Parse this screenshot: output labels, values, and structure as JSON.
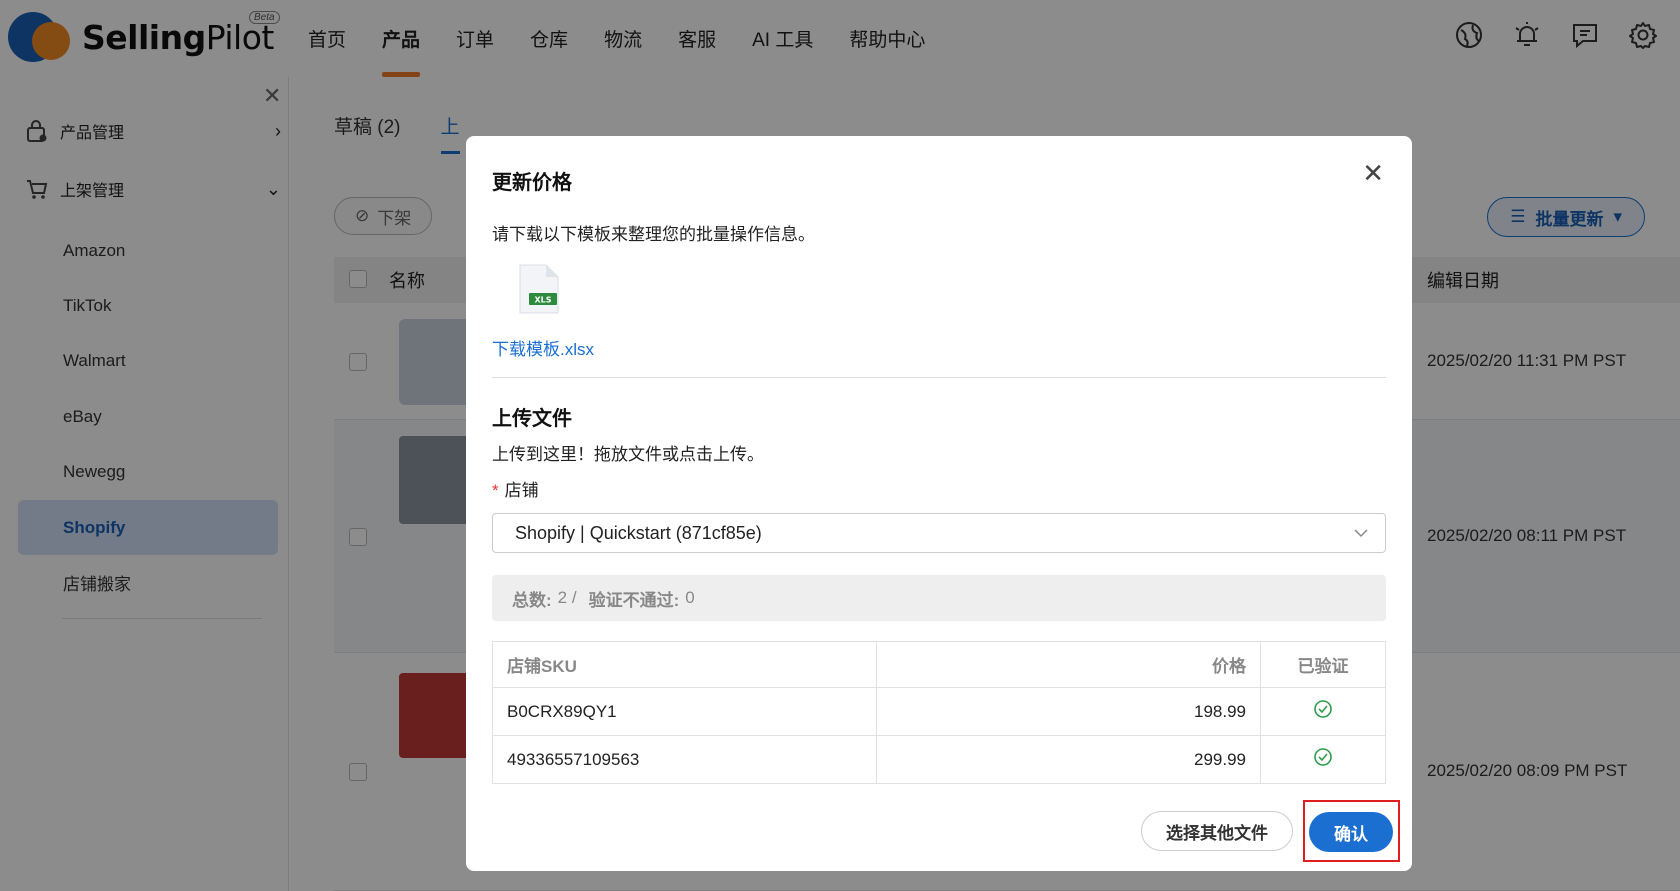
{
  "brand": {
    "name_bold": "Selling",
    "name_rest": "Pilot",
    "badge": "Beta"
  },
  "nav": {
    "items": [
      "首页",
      "产品",
      "订单",
      "仓库",
      "物流",
      "客服",
      "AI 工具",
      "帮助中心"
    ],
    "active": "产品"
  },
  "top_icons": [
    "globe-icon",
    "bell-icon",
    "chat-icon",
    "gear-icon"
  ],
  "sidebar": {
    "groups": [
      "产品管理",
      "上架管理"
    ],
    "items": [
      "Amazon",
      "TikTok",
      "Walmart",
      "eBay",
      "Newegg",
      "Shopify",
      "店铺搬家"
    ],
    "active": "Shopify"
  },
  "main": {
    "tabs": [
      "草稿 (2)",
      "上"
    ],
    "delist_label": "下架",
    "bulk_label": "批量更新",
    "columns": {
      "name": "名称",
      "edit_date": "编辑日期"
    },
    "rows": [
      {
        "date": "2025/02/20 11:31 PM PST"
      },
      {
        "date": "2025/02/20 08:11 PM PST"
      },
      {
        "date": "2025/02/20 08:09 PM PST"
      }
    ]
  },
  "modal": {
    "title": "更新价格",
    "hint": "请下载以下模板来整理您的批量操作信息。",
    "file_badge": "XLS",
    "download_link": "下载模板.xlsx",
    "upload_title": "上传文件",
    "upload_hint": "上传到这里！拖放文件或点击上传。",
    "store_label": "店铺",
    "store_value": "Shopify | Quickstart (871cf85e)",
    "summary": {
      "total_label": "总数:",
      "total": "2 /",
      "failed_label": "验证不通过:",
      "failed": "0"
    },
    "table": {
      "headers": {
        "sku": "店铺SKU",
        "price": "价格",
        "verified": "已验证"
      },
      "rows": [
        {
          "sku": "B0CRX89QY1",
          "price": "198.99"
        },
        {
          "sku": "49336557109563",
          "price": "299.99"
        }
      ]
    },
    "other_file_button": "选择其他文件",
    "confirm_button": "确认"
  }
}
